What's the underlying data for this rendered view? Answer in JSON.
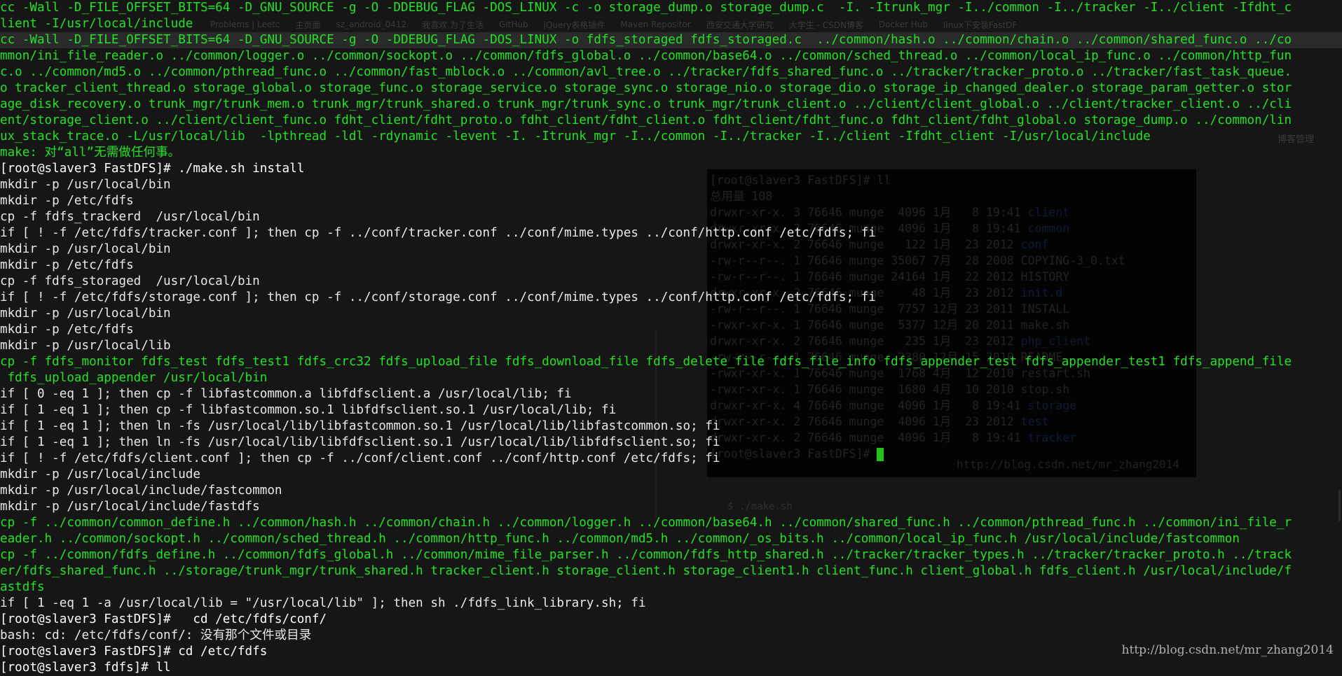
{
  "background": {
    "browser_tabs": [
      "Problems | Leetc",
      "主页面",
      "sz_android_0412",
      "我喜欢 为了生活",
      "GitHub",
      "jQuery表格插件",
      "Maven Repositor",
      "西安交通大学研究",
      "大学生 - CSDN博客",
      "Docker Hub",
      "linux下安装FastDF"
    ],
    "sidebar_text": "博客管理",
    "inner_terminal": {
      "lines": [
        {
          "text": "[root@slaver3 FastDFS]# ll",
          "blue": ""
        },
        {
          "text": "总用量 108",
          "blue": ""
        },
        {
          "text": "drwxr-xr-x. 3 76646 munge  4096 1月   8 19:41 ",
          "blue": "client"
        },
        {
          "text": "drwxr-xr-x. 2 76646 munge  4096 1月   8 19:41 ",
          "blue": "common"
        },
        {
          "text": "drwxr-xr-x. 2 76646 munge   122 1月  23 2012 ",
          "blue": "conf"
        },
        {
          "text": "-rw-r--r--. 1 76646 munge 35067 7月  28 2008 COPYING-3_0.txt",
          "blue": ""
        },
        {
          "text": "-rw-r--r--. 1 76646 munge 24164 1月  22 2012 HISTORY",
          "blue": ""
        },
        {
          "text": "drwxr-xr-x. 2 76646 munge    48 1月  23 2012 ",
          "blue": "init.d"
        },
        {
          "text": "-rw-r--r--. 1 76646 munge  7757 12月 23 2011 INSTALL",
          "blue": ""
        },
        {
          "text": "-rwxr-xr-x. 1 76646 munge  5377 12月 20 2011 make.sh",
          "blue": ""
        },
        {
          "text": "drwxr-xr-x. 2 76646 munge   235 1月  23 2012 ",
          "blue": "php_client"
        },
        {
          "text": "-rw-r--r--. 1 76646 munge  2380 12月 15 2010 README",
          "blue": ""
        },
        {
          "text": "-rwxr-xr-x. 1 76646 munge  1768 4月  12 2010 restart.sh",
          "blue": ""
        },
        {
          "text": "-rwxr-xr-x. 1 76646 munge  1680 4月  10 2010 stop.sh",
          "blue": ""
        },
        {
          "text": "drwxr-xr-x. 4 76646 munge  4096 1月   8 19:41 ",
          "blue": "storage"
        },
        {
          "text": "drwxr-xr-x. 2 76646 munge  4096 1月  23 2012 ",
          "blue": "test"
        },
        {
          "text": "drwxr-xr-x. 2 76646 munge  4096 1月   8 19:41 ",
          "blue": "tracker"
        },
        {
          "text": "[root@slaver3 FastDFS]# ",
          "blue": ""
        }
      ],
      "watermark": "http://blog.csdn.net/mr_zhang2014",
      "below_label": "$ ./make.sh"
    }
  },
  "terminal": {
    "lines": [
      {
        "text": "cc -Wall -D_FILE_OFFSET_BITS=64 -D_GNU_SOURCE -g -O -DDEBUG_FLAG -DOS_LINUX -c -o storage_dump.o storage_dump.c  -I. -Itrunk_mgr -I../common -I../tracker -I../client -Ifdht_c",
        "style": "green"
      },
      {
        "text": "lient -I/usr/local/include",
        "style": "green"
      },
      {
        "text": "cc -Wall -D_FILE_OFFSET_BITS=64 -D_GNU_SOURCE -g -O -DDEBUG_FLAG -DOS_LINUX -o fdfs_storaged fdfs_storaged.c  ../common/hash.o ../common/chain.o ../common/shared_func.o ../co",
        "style": "green hl"
      },
      {
        "text": "mmon/ini_file_reader.o ../common/logger.o ../common/sockopt.o ../common/fdfs_global.o ../common/base64.o ../common/sched_thread.o ../common/local_ip_func.o ../common/http_fun",
        "style": "green"
      },
      {
        "text": "c.o ../common/md5.o ../common/pthread_func.o ../common/fast_mblock.o ../common/avl_tree.o ../tracker/fdfs_shared_func.o ../tracker/tracker_proto.o ../tracker/fast_task_queue.",
        "style": "green"
      },
      {
        "text": "o tracker_client_thread.o storage_global.o storage_func.o storage_service.o storage_sync.o storage_nio.o storage_dio.o storage_ip_changed_dealer.o storage_param_getter.o stor",
        "style": "green"
      },
      {
        "text": "age_disk_recovery.o trunk_mgr/trunk_mem.o trunk_mgr/trunk_shared.o trunk_mgr/trunk_sync.o trunk_mgr/trunk_client.o ../client/client_global.o ../client/tracker_client.o ../cli",
        "style": "green"
      },
      {
        "text": "ent/storage_client.o ../client/client_func.o fdht_client/fdht_proto.o fdht_client/fdht_client.o fdht_client/fdht_func.o fdht_client/fdht_global.o storage_dump.o ../common/lin",
        "style": "green"
      },
      {
        "text": "ux_stack_trace.o -L/usr/local/lib  -lpthread -ldl -rdynamic -levent -I. -Itrunk_mgr -I../common -I../tracker -I../client -Ifdht_client -I/usr/local/include",
        "style": "green"
      },
      {
        "text": "make: 对“all”无需做任何事。",
        "style": "green"
      },
      {
        "text": "[root@slaver3 FastDFS]# ./make.sh install",
        "style": "prompt"
      },
      {
        "text": "mkdir -p /usr/local/bin",
        "style": "white"
      },
      {
        "text": "mkdir -p /etc/fdfs",
        "style": "white"
      },
      {
        "text": "cp -f fdfs_trackerd  /usr/local/bin",
        "style": "white"
      },
      {
        "text": "if [ ! -f /etc/fdfs/tracker.conf ]; then cp -f ../conf/tracker.conf ../conf/mime.types ../conf/http.conf /etc/fdfs; fi",
        "style": "white"
      },
      {
        "text": "mkdir -p /usr/local/bin",
        "style": "white"
      },
      {
        "text": "mkdir -p /etc/fdfs",
        "style": "white"
      },
      {
        "text": "cp -f fdfs_storaged  /usr/local/bin",
        "style": "white"
      },
      {
        "text": "if [ ! -f /etc/fdfs/storage.conf ]; then cp -f ../conf/storage.conf ../conf/mime.types ../conf/http.conf /etc/fdfs; fi",
        "style": "white"
      },
      {
        "text": "mkdir -p /usr/local/bin",
        "style": "white"
      },
      {
        "text": "mkdir -p /etc/fdfs",
        "style": "white"
      },
      {
        "text": "mkdir -p /usr/local/lib",
        "style": "white"
      },
      {
        "text": "cp -f fdfs_monitor fdfs_test fdfs_test1 fdfs_crc32 fdfs_upload_file fdfs_download_file fdfs_delete_file fdfs_file_info fdfs_appender_test fdfs_appender_test1 fdfs_append_file",
        "style": "green"
      },
      {
        "text": " fdfs_upload_appender /usr/local/bin",
        "style": "green"
      },
      {
        "text": "if [ 0 -eq 1 ]; then cp -f libfastcommon.a libfdfsclient.a /usr/local/lib; fi",
        "style": "white"
      },
      {
        "text": "if [ 1 -eq 1 ]; then cp -f libfastcommon.so.1 libfdfsclient.so.1 /usr/local/lib; fi",
        "style": "white"
      },
      {
        "text": "if [ 1 -eq 1 ]; then ln -fs /usr/local/lib/libfastcommon.so.1 /usr/local/lib/libfastcommon.so; fi",
        "style": "white"
      },
      {
        "text": "if [ 1 -eq 1 ]; then ln -fs /usr/local/lib/libfdfsclient.so.1 /usr/local/lib/libfdfsclient.so; fi",
        "style": "white"
      },
      {
        "text": "if [ ! -f /etc/fdfs/client.conf ]; then cp -f ../conf/client.conf ../conf/http.conf /etc/fdfs; fi",
        "style": "white"
      },
      {
        "text": "mkdir -p /usr/local/include",
        "style": "white"
      },
      {
        "text": "mkdir -p /usr/local/include/fastcommon",
        "style": "white"
      },
      {
        "text": "mkdir -p /usr/local/include/fastdfs",
        "style": "white"
      },
      {
        "text": "cp -f ../common/common_define.h ../common/hash.h ../common/chain.h ../common/logger.h ../common/base64.h ../common/shared_func.h ../common/pthread_func.h ../common/ini_file_r",
        "style": "green"
      },
      {
        "text": "eader.h ../common/sockopt.h ../common/sched_thread.h ../common/http_func.h ../common/md5.h ../common/_os_bits.h ../common/local_ip_func.h /usr/local/include/fastcommon",
        "style": "green"
      },
      {
        "text": "cp -f ../common/fdfs_define.h ../common/fdfs_global.h ../common/mime_file_parser.h ../common/fdfs_http_shared.h ../tracker/tracker_types.h ../tracker/tracker_proto.h ../track",
        "style": "green"
      },
      {
        "text": "er/fdfs_shared_func.h ../storage/trunk_mgr/trunk_shared.h tracker_client.h storage_client.h storage_client1.h client_func.h client_global.h fdfs_client.h /usr/local/include/f",
        "style": "green"
      },
      {
        "text": "astdfs",
        "style": "green"
      },
      {
        "text": "if [ 1 -eq 1 -a /usr/local/lib = \"/usr/local/lib\" ]; then sh ./fdfs_link_library.sh; fi",
        "style": "white"
      },
      {
        "text": "[root@slaver3 FastDFS]#   cd /etc/fdfs/conf/",
        "style": "prompt"
      },
      {
        "text": "bash: cd: /etc/fdfs/conf/: 没有那个文件或目录",
        "style": "white"
      },
      {
        "text": "[root@slaver3 FastDFS]# cd /etc/fdfs",
        "style": "prompt"
      },
      {
        "text": "[root@slaver3 fdfs]# ll",
        "style": "prompt"
      }
    ],
    "watermark": "http://blog.csdn.net/mr_zhang2014"
  }
}
